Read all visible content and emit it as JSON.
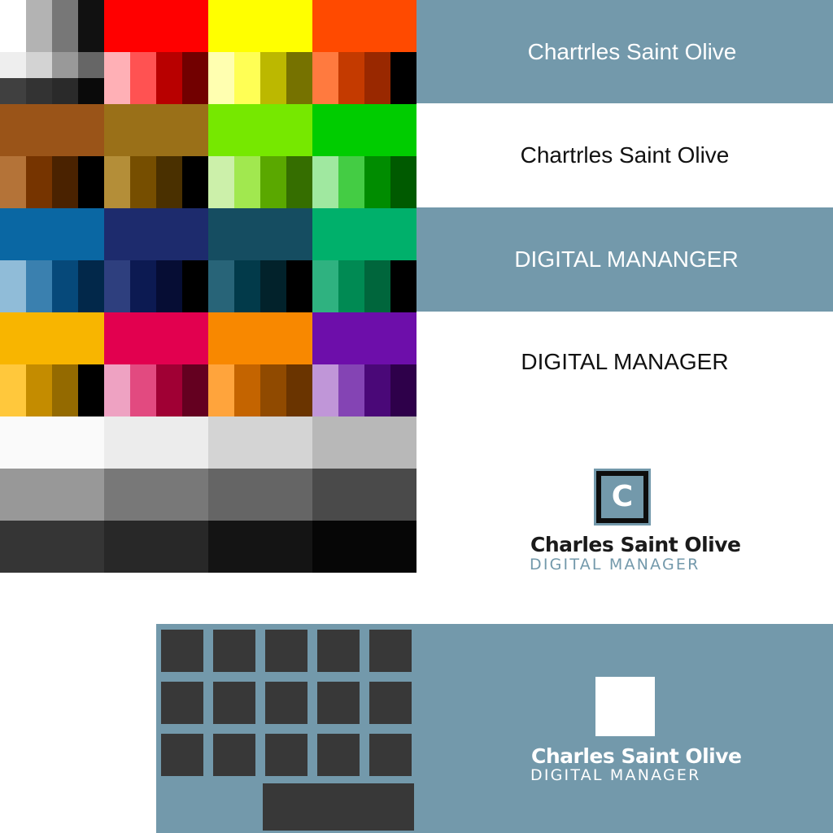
{
  "palette": {
    "rows": [
      {
        "main": [
          "",
          "#ff0000",
          "#ffff00",
          "#ff4a00"
        ],
        "shades": [
          [
            "#eeeeee",
            "#d3d3d3",
            "#999999",
            "#666666"
          ],
          [
            "#ffb0b6",
            "#ff5252",
            "#b80000",
            "#720000"
          ],
          [
            "#ffffb0",
            "#ffff55",
            "#bcb800",
            "#767200"
          ],
          [
            "#ff7a3f",
            "#c43a00",
            "#992800",
            "#000000"
          ]
        ]
      },
      {
        "main": [
          "#9a5418",
          "#9a7018",
          "#76e800",
          "#00cc00"
        ],
        "shades": [
          [
            "#b47338",
            "#763400",
            "#4a2200",
            "#000000"
          ],
          [
            "#b48e38",
            "#764e00",
            "#4a3000",
            "#000000"
          ],
          [
            "#ccf0aa",
            "#a1e84f",
            "#5aa800",
            "#356e00"
          ],
          [
            "#a0e8a0",
            "#44cc44",
            "#008c00",
            "#005a00"
          ]
        ]
      },
      {
        "main": [
          "#0a67a3",
          "#1d2b6d",
          "#154d61",
          "#00b06b"
        ],
        "shades": [
          [
            "#90bcd8",
            "#3a80af",
            "#06497a",
            "#02284a"
          ],
          [
            "#2e3f7e",
            "#0c1a52",
            "#060d34",
            "#000000"
          ],
          [
            "#286478",
            "#023a4a",
            "#02222b",
            "#000000"
          ],
          [
            "#2fb280",
            "#008a53",
            "#00663c",
            "#000000"
          ]
        ]
      },
      {
        "main": [
          "#f8b500",
          "#e2004f",
          "#f88800",
          "#6d0eaa"
        ],
        "shades": [
          [
            "#ffc83c",
            "#c48c00",
            "#946a00",
            "#000000"
          ],
          [
            "#eea2c2",
            "#e24a80",
            "#a00034",
            "#640020"
          ],
          [
            "#ffa43c",
            "#c46400",
            "#904a00",
            "#6a3400"
          ],
          [
            "#c096d8",
            "#8444b4",
            "#4a0878",
            "#2e004a"
          ]
        ]
      }
    ],
    "gray_corner": [
      "#ffffff",
      "#b3b3b3",
      "#777777",
      "#111111"
    ],
    "gray_bottom": [
      "#404040",
      "#333333",
      "#2a2a2a",
      "#0a0a0a"
    ],
    "neutrals": [
      [
        "#fafafa",
        "#ececec",
        "#d4d4d4",
        "#b8b8b8"
      ],
      [
        "#989898",
        "#787878",
        "#656565",
        "#4a4a4a"
      ],
      [
        "#353535",
        "#282828",
        "#141414",
        "#060606"
      ]
    ]
  },
  "accent": "#7399ab",
  "tile_color": "#383838",
  "bands": [
    {
      "text": "Chartrles Saint Olive",
      "style": "blue"
    },
    {
      "text": "Chartrles Saint Olive",
      "style": "white"
    },
    {
      "text": "DIGITAL MANANGER",
      "style": "blue"
    },
    {
      "text": "DIGITAL MANAGER",
      "style": "white"
    }
  ],
  "logo_light": {
    "letter": "C",
    "name": "Charles Saint Olive",
    "role": "DIGITAL MANAGER"
  },
  "logo_dark": {
    "name": "Charles Saint Olive",
    "role": "DIGITAL MANAGER"
  }
}
